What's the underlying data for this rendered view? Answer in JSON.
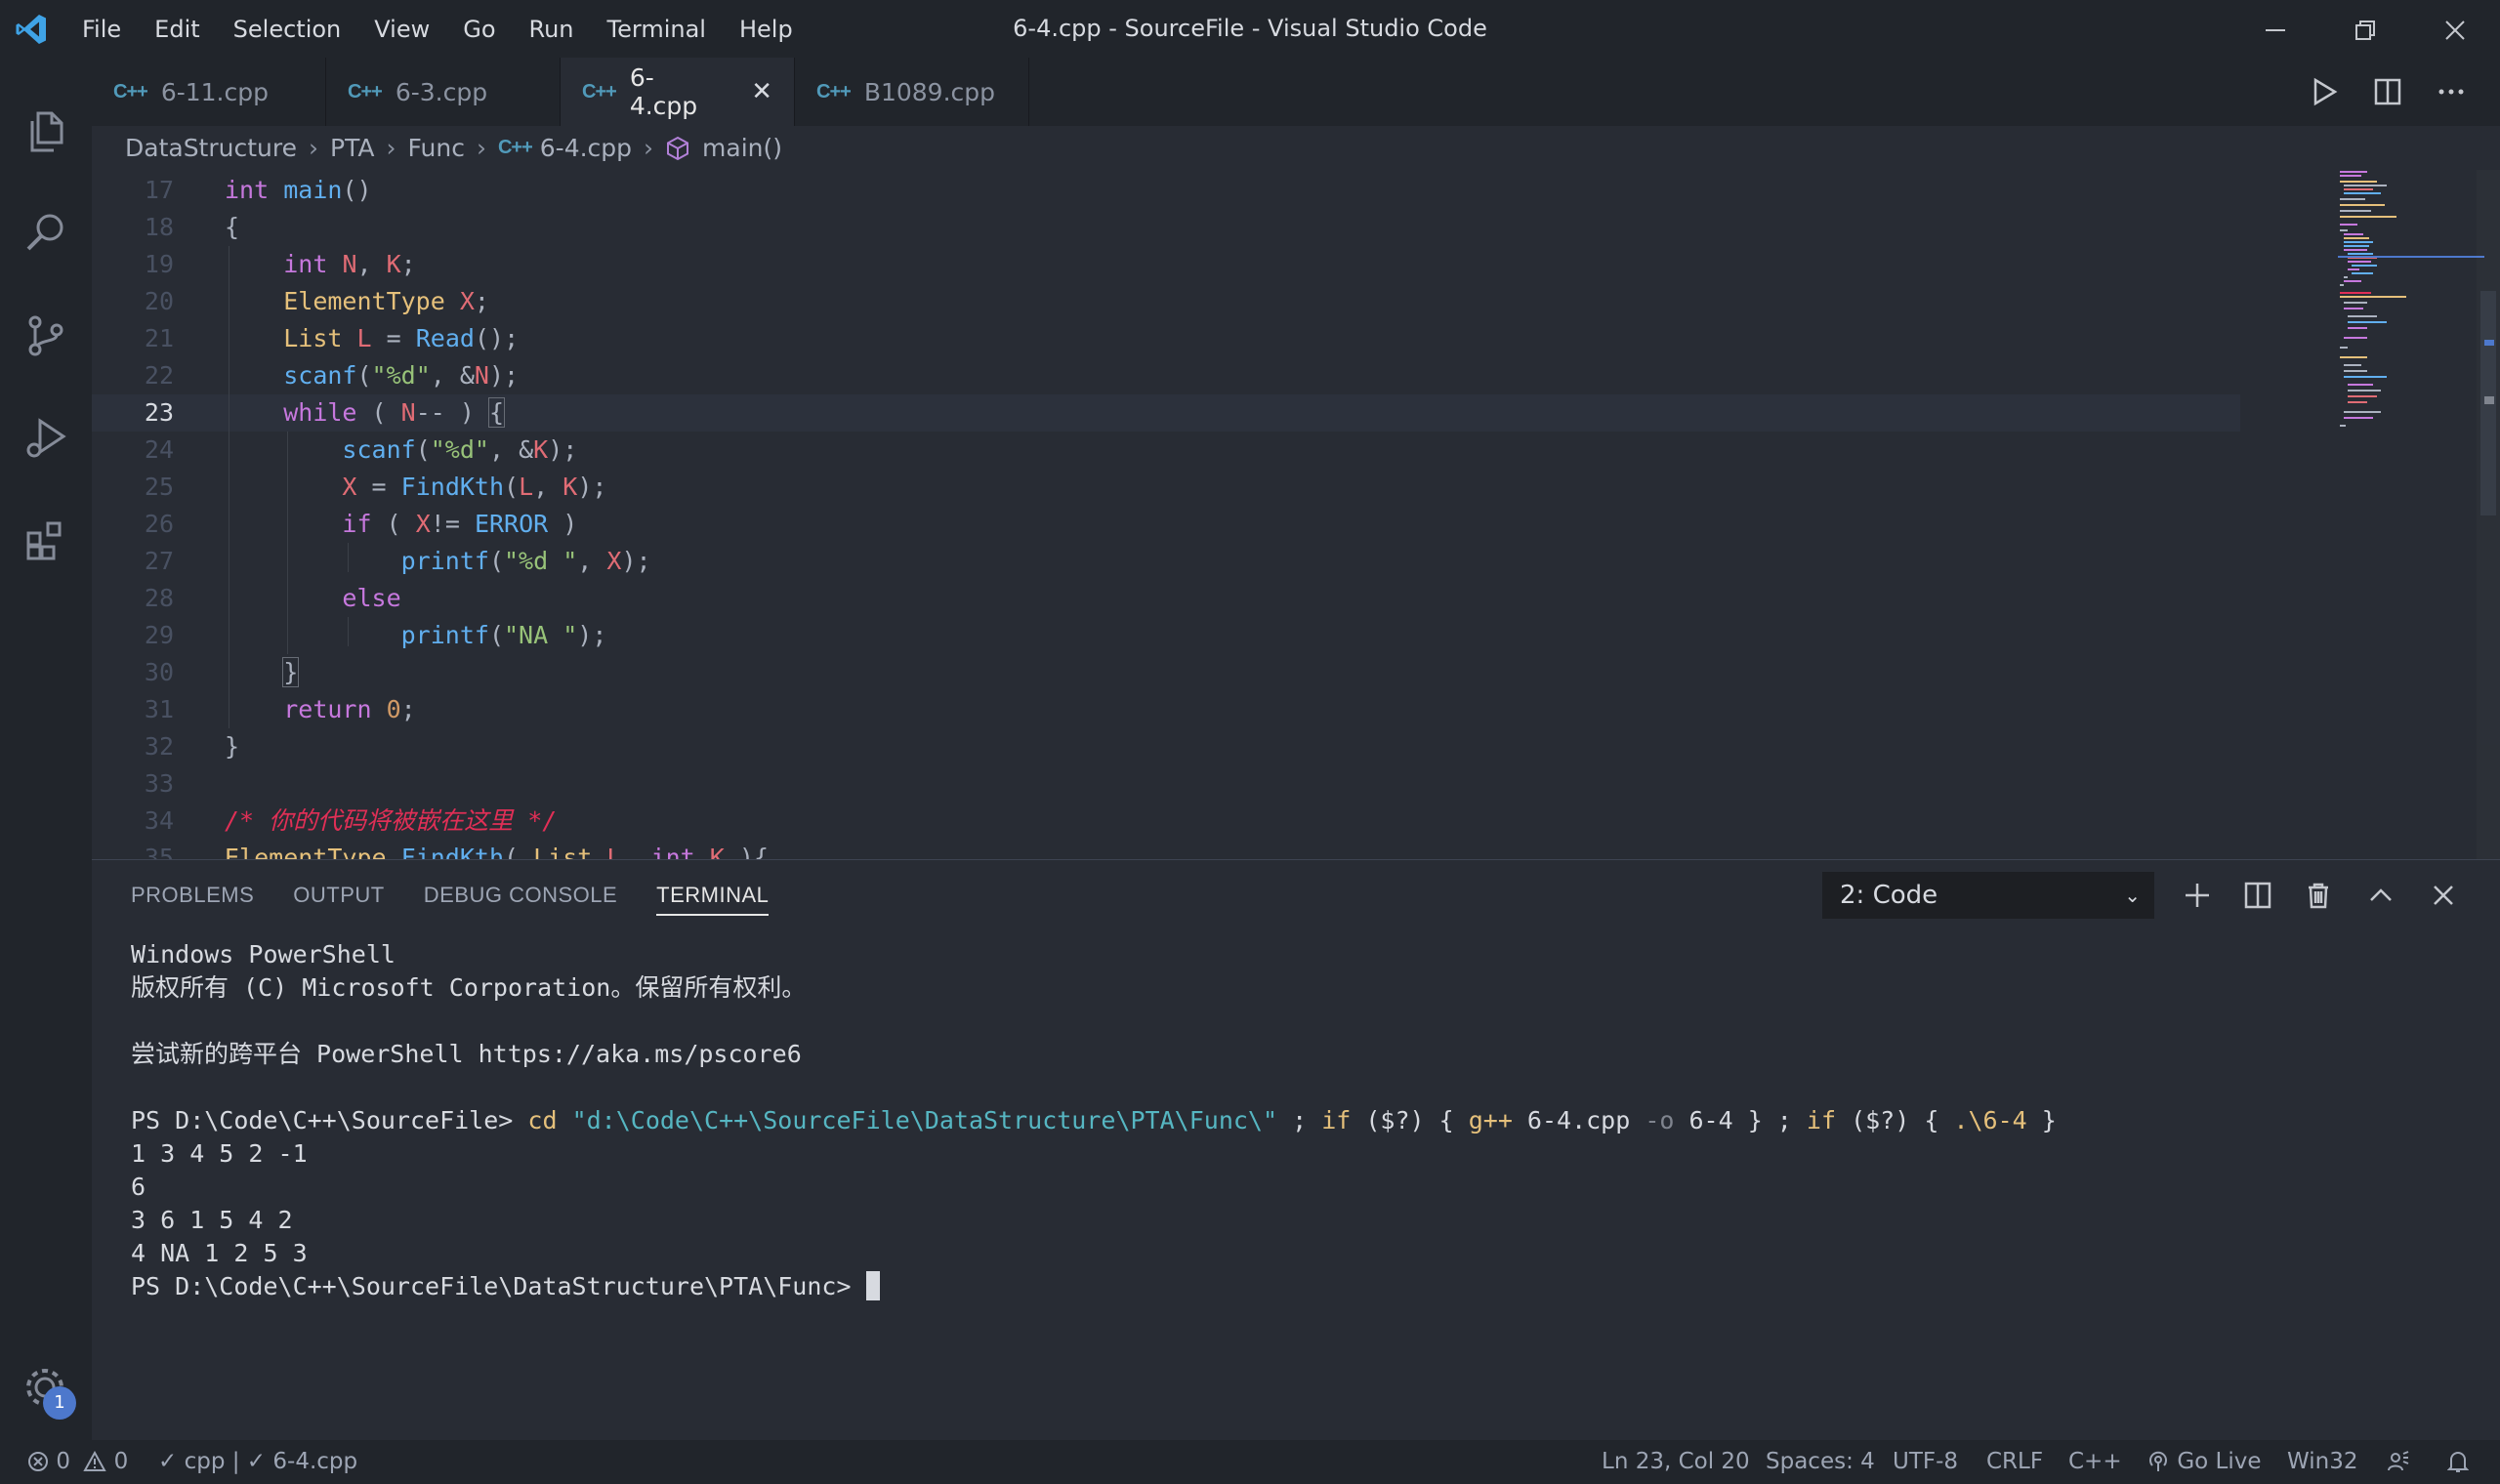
{
  "window": {
    "title": "6-4.cpp - SourceFile - Visual Studio Code"
  },
  "menu": [
    "File",
    "Edit",
    "Selection",
    "View",
    "Go",
    "Run",
    "Terminal",
    "Help"
  ],
  "tabs": [
    {
      "label": "6-11.cpp",
      "icon": "C++"
    },
    {
      "label": "6-3.cpp",
      "icon": "C++"
    },
    {
      "label": "6-4.cpp",
      "icon": "C++",
      "active": true
    },
    {
      "label": "B1089.cpp",
      "icon": "C++"
    }
  ],
  "breadcrumb": {
    "items": [
      "DataStructure",
      "PTA",
      "Func"
    ],
    "file": "6-4.cpp",
    "file_icon": "C++",
    "symbol": "main()"
  },
  "editor": {
    "line_numbers": [
      "17",
      "18",
      "19",
      "20",
      "21",
      "22",
      "23",
      "24",
      "25",
      "26",
      "27",
      "28",
      "29",
      "30",
      "31",
      "32",
      "33",
      "34",
      "35"
    ],
    "current_line": "23"
  },
  "panel": {
    "tabs": [
      "PROBLEMS",
      "OUTPUT",
      "DEBUG CONSOLE",
      "TERMINAL"
    ],
    "active_tab": "TERMINAL",
    "terminal_select": "2: Code",
    "terminal_lines": [
      "Windows PowerShell",
      "版权所有 (C) Microsoft Corporation。保留所有权利。",
      "",
      "尝试新的跨平台 PowerShell https://aka.ms/pscore6",
      "",
      "__CMD__",
      "1 3 4 5 2 -1",
      "6",
      "3 6 1 5 4 2",
      "4 NA 1 2 5 3",
      "__PROMPT__"
    ],
    "prompt1": "PS D:\\Code\\C++\\SourceFile> ",
    "cmd": {
      "cd": "cd",
      "path": "\"d:\\Code\\C++\\SourceFile\\DataStructure\\PTA\\Func\\\"",
      "rest1": " ; ",
      "if1": "if",
      "cond1": " ($?) { ",
      "gpp": "g++",
      "args": " 6-4.cpp ",
      "flag": "-o",
      "out": " 6-4 } ; ",
      "if2": "if",
      "cond2": " ($?) { ",
      "run": ".\\6-4",
      "end": " }"
    },
    "prompt2": "PS D:\\Code\\C++\\SourceFile\\DataStructure\\PTA\\Func> "
  },
  "status": {
    "errors": "0",
    "warnings": "0",
    "checks": "✓ cpp | ✓ 6-4.cpp",
    "position": "Ln 23, Col 20",
    "spaces": "Spaces: 4",
    "encoding": "UTF-8",
    "eol": "CRLF",
    "language": "C++",
    "golive": "Go Live",
    "platform": "Win32"
  },
  "activity": {
    "notification_count": "1"
  },
  "icons": [
    "vscode-logo-icon",
    "explorer-icon",
    "search-icon",
    "source-control-icon",
    "run-debug-icon",
    "extensions-icon",
    "settings-gear-icon",
    "run-icon",
    "split-editor-icon",
    "more-icon",
    "add-terminal-icon",
    "split-terminal-icon",
    "trash-icon",
    "maximize-panel-icon",
    "close-panel-icon",
    "error-icon",
    "warning-icon",
    "broadcast-icon",
    "feedback-icon",
    "bell-icon"
  ],
  "colors": {
    "accent": "#4d78cc",
    "keyword": "#c678dd",
    "function": "#61afef",
    "type": "#e5c07b",
    "variable": "#e06c75",
    "string": "#98c379",
    "number": "#d19a66",
    "comment": "#e02f56"
  }
}
